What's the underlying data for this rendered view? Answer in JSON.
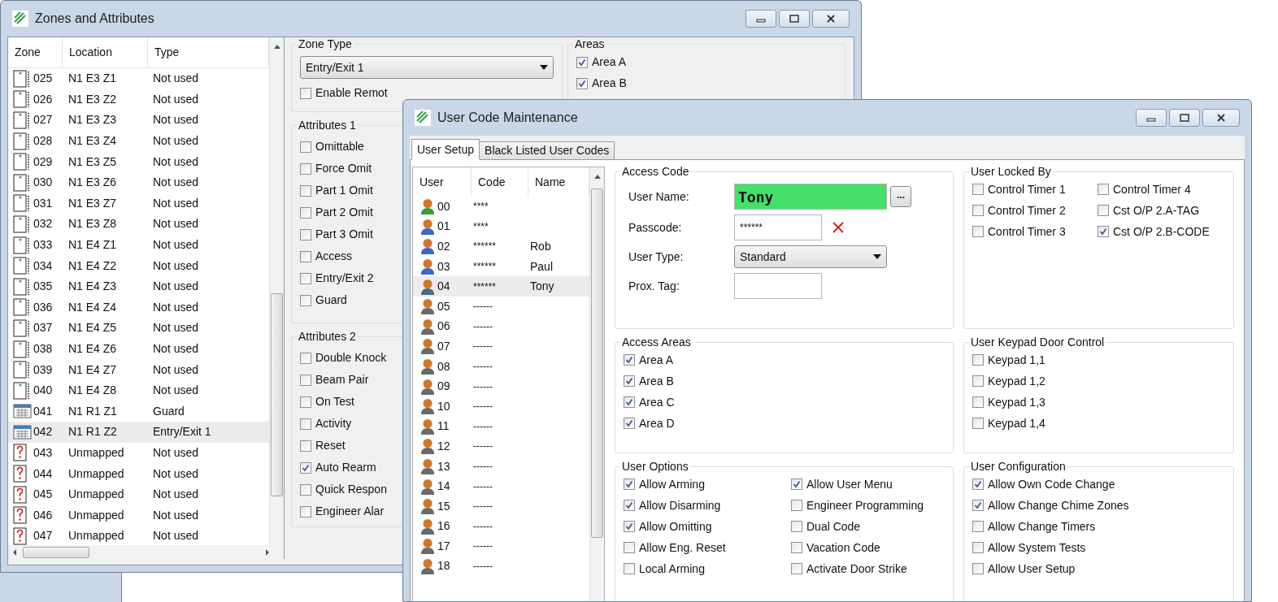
{
  "zones_window": {
    "title": "Zones and Attributes",
    "zone_list": {
      "columns": [
        "Zone",
        "Location",
        "Type"
      ],
      "rows": [
        {
          "kind": "detector",
          "zone": "025",
          "location": "N1 E3 Z1",
          "type": "Not used",
          "selected": false
        },
        {
          "kind": "detector",
          "zone": "026",
          "location": "N1 E3 Z2",
          "type": "Not used",
          "selected": false
        },
        {
          "kind": "detector",
          "zone": "027",
          "location": "N1 E3 Z3",
          "type": "Not used",
          "selected": false
        },
        {
          "kind": "detector",
          "zone": "028",
          "location": "N1 E3 Z4",
          "type": "Not used",
          "selected": false
        },
        {
          "kind": "detector",
          "zone": "029",
          "location": "N1 E3 Z5",
          "type": "Not used",
          "selected": false
        },
        {
          "kind": "detector",
          "zone": "030",
          "location": "N1 E3 Z6",
          "type": "Not used",
          "selected": false
        },
        {
          "kind": "detector",
          "zone": "031",
          "location": "N1 E3 Z7",
          "type": "Not used",
          "selected": false
        },
        {
          "kind": "detector",
          "zone": "032",
          "location": "N1 E3 Z8",
          "type": "Not used",
          "selected": false
        },
        {
          "kind": "detector",
          "zone": "033",
          "location": "N1 E4 Z1",
          "type": "Not used",
          "selected": false
        },
        {
          "kind": "detector",
          "zone": "034",
          "location": "N1 E4 Z2",
          "type": "Not used",
          "selected": false
        },
        {
          "kind": "detector",
          "zone": "035",
          "location": "N1 E4 Z3",
          "type": "Not used",
          "selected": false
        },
        {
          "kind": "detector",
          "zone": "036",
          "location": "N1 E4 Z4",
          "type": "Not used",
          "selected": false
        },
        {
          "kind": "detector",
          "zone": "037",
          "location": "N1 E4 Z5",
          "type": "Not used",
          "selected": false
        },
        {
          "kind": "detector",
          "zone": "038",
          "location": "N1 E4 Z6",
          "type": "Not used",
          "selected": false
        },
        {
          "kind": "detector",
          "zone": "039",
          "location": "N1 E4 Z7",
          "type": "Not used",
          "selected": false
        },
        {
          "kind": "detector",
          "zone": "040",
          "location": "N1 E4 Z8",
          "type": "Not used",
          "selected": false
        },
        {
          "kind": "keypad",
          "zone": "041",
          "location": "N1 R1 Z1",
          "type": "Guard",
          "selected": false
        },
        {
          "kind": "keypad",
          "zone": "042",
          "location": "N1 R1 Z2",
          "type": "Entry/Exit 1",
          "selected": true
        },
        {
          "kind": "unmapped",
          "zone": "043",
          "location": "Unmapped",
          "type": "Not used",
          "selected": false
        },
        {
          "kind": "unmapped",
          "zone": "044",
          "location": "Unmapped",
          "type": "Not used",
          "selected": false
        },
        {
          "kind": "unmapped",
          "zone": "045",
          "location": "Unmapped",
          "type": "Not used",
          "selected": false
        },
        {
          "kind": "unmapped",
          "zone": "046",
          "location": "Unmapped",
          "type": "Not used",
          "selected": false
        },
        {
          "kind": "unmapped",
          "zone": "047",
          "location": "Unmapped",
          "type": "Not used",
          "selected": false
        }
      ]
    },
    "zone_type": {
      "label": "Zone Type",
      "value": "Entry/Exit 1",
      "remote": {
        "label": "Enable Remot",
        "checked": false
      }
    },
    "attributes_1": {
      "label": "Attributes 1",
      "items": [
        {
          "label": "Omittable",
          "checked": false
        },
        {
          "label": "Force Omit",
          "checked": false
        },
        {
          "label": "Part 1 Omit",
          "checked": false
        },
        {
          "label": "Part 2 Omit",
          "checked": false
        },
        {
          "label": "Part 3 Omit",
          "checked": false
        },
        {
          "label": "Access",
          "checked": false
        },
        {
          "label": "Entry/Exit 2",
          "checked": false
        },
        {
          "label": "Guard",
          "checked": false
        }
      ]
    },
    "attributes_2": {
      "label": "Attributes 2",
      "items": [
        {
          "label": "Double Knock",
          "checked": false
        },
        {
          "label": "Beam Pair",
          "checked": false
        },
        {
          "label": "On Test",
          "checked": false
        },
        {
          "label": "Activity",
          "checked": false
        },
        {
          "label": "Reset",
          "checked": false
        },
        {
          "label": "Auto Rearm",
          "checked": true
        },
        {
          "label": "Quick Respon",
          "checked": false
        },
        {
          "label": "Engineer Alar",
          "checked": false
        }
      ]
    },
    "areas": {
      "label": "Areas",
      "items": [
        {
          "label": "Area A",
          "checked": true
        },
        {
          "label": "Area B",
          "checked": true
        }
      ]
    }
  },
  "user_window": {
    "title": "User Code Maintenance",
    "tabs": [
      {
        "label": "User Setup",
        "selected": true
      },
      {
        "label": "Black Listed User Codes",
        "selected": false
      }
    ],
    "user_list": {
      "columns": [
        "User",
        "Code",
        "Name"
      ],
      "rows": [
        {
          "user": "00",
          "code": "****",
          "color": "#3a9a3a",
          "selected": false
        },
        {
          "user": "01",
          "code": "****",
          "color": "#3b68c8",
          "selected": false
        },
        {
          "user": "02",
          "code": "******",
          "name": "Rob",
          "color": "#3b68c8",
          "selected": false
        },
        {
          "user": "03",
          "code": "******",
          "name": "Paul",
          "color": "#3b68c8",
          "selected": false
        },
        {
          "user": "04",
          "code": "******",
          "name": "Tony",
          "color": "#4a6a8a",
          "selected": true
        },
        {
          "user": "05",
          "code": "------",
          "color": "#6a6a6a",
          "selected": false
        },
        {
          "user": "06",
          "code": "------",
          "color": "#6a6a6a",
          "selected": false
        },
        {
          "user": "07",
          "code": "------",
          "color": "#6a6a6a",
          "selected": false
        },
        {
          "user": "08",
          "code": "------",
          "color": "#6a6a6a",
          "selected": false
        },
        {
          "user": "09",
          "code": "------",
          "color": "#6a6a6a",
          "selected": false
        },
        {
          "user": "10",
          "code": "------",
          "color": "#6a6a6a",
          "selected": false
        },
        {
          "user": "11",
          "code": "------",
          "color": "#6a6a6a",
          "selected": false
        },
        {
          "user": "12",
          "code": "------",
          "color": "#6a6a6a",
          "selected": false
        },
        {
          "user": "13",
          "code": "------",
          "color": "#6a6a6a",
          "selected": false
        },
        {
          "user": "14",
          "code": "------",
          "color": "#6a6a6a",
          "selected": false
        },
        {
          "user": "15",
          "code": "------",
          "color": "#6a6a6a",
          "selected": false
        },
        {
          "user": "16",
          "code": "------",
          "color": "#6a6a6a",
          "selected": false
        },
        {
          "user": "17",
          "code": "------",
          "color": "#6a6a6a",
          "selected": false
        },
        {
          "user": "18",
          "code": "------",
          "color": "#6a6a6a",
          "selected": false
        }
      ]
    },
    "access_code": {
      "label": "Access Code",
      "user_name_label": "User Name:",
      "user_name": "Tony",
      "browse_button": "...",
      "passcode_label": "Passcode:",
      "passcode": "******",
      "user_type_label": "User Type:",
      "user_type": "Standard",
      "prox_tag_label": "Prox. Tag:"
    },
    "locked_by": {
      "label": "User Locked By",
      "items": [
        {
          "label": "Control Timer 1",
          "checked": false
        },
        {
          "label": "Control Timer 4",
          "checked": false
        },
        {
          "label": "Control Timer 2",
          "checked": false
        },
        {
          "label": "Cst O/P 2.A-TAG",
          "checked": false
        },
        {
          "label": "Control Timer 3",
          "checked": false
        },
        {
          "label": "Cst O/P 2.B-CODE",
          "checked": true
        }
      ]
    },
    "access_areas": {
      "label": "Access Areas",
      "items": [
        {
          "label": "Area A",
          "checked": true
        },
        {
          "label": "Area B",
          "checked": true
        },
        {
          "label": "Area C",
          "checked": true
        },
        {
          "label": "Area D",
          "checked": true
        }
      ]
    },
    "keypad_door": {
      "label": "User Keypad Door Control",
      "items": [
        {
          "label": "Keypad 1,1",
          "checked": false
        },
        {
          "label": "Keypad 1,2",
          "checked": false
        },
        {
          "label": "Keypad 1,3",
          "checked": false
        },
        {
          "label": "Keypad 1,4",
          "checked": false
        }
      ]
    },
    "user_options": {
      "label": "User Options",
      "items": [
        {
          "label": "Allow Arming",
          "checked": true
        },
        {
          "label": "Allow User Menu",
          "checked": true
        },
        {
          "label": "Allow Disarming",
          "checked": true
        },
        {
          "label": "Engineer Programming",
          "checked": false
        },
        {
          "label": "Allow Omitting",
          "checked": true
        },
        {
          "label": "Dual Code",
          "checked": false
        },
        {
          "label": "Allow Eng. Reset",
          "checked": false
        },
        {
          "label": "Vacation Code",
          "checked": false
        },
        {
          "label": "Local Arming",
          "checked": false
        },
        {
          "label": "Activate Door Strike",
          "checked": false
        }
      ]
    },
    "user_config": {
      "label": "User Configuration",
      "items": [
        {
          "label": "Allow Own Code Change",
          "checked": true
        },
        {
          "label": "Allow Change Chime Zones",
          "checked": true
        },
        {
          "label": "Allow Change Timers",
          "checked": false
        },
        {
          "label": "Allow System Tests",
          "checked": false
        },
        {
          "label": "Allow User Setup",
          "checked": false
        }
      ]
    }
  }
}
